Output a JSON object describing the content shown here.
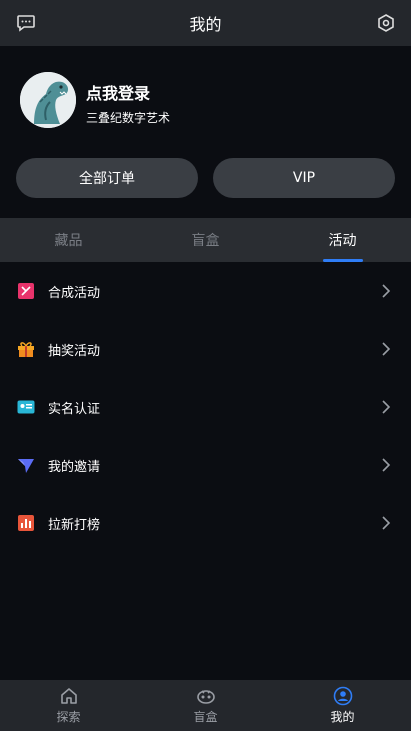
{
  "header": {
    "title": "我的",
    "left_icon": "chat-bubble-icon",
    "right_icon": "settings-hexagon-icon"
  },
  "profile": {
    "login_text": "点我登录",
    "subtitle": "三叠纪数字艺术",
    "avatar": "dinosaur-avatar"
  },
  "actions": {
    "orders_label": "全部订单",
    "vip_label": "VIP"
  },
  "tabs": [
    {
      "label": "藏品",
      "active": false
    },
    {
      "label": "盲盒",
      "active": false
    },
    {
      "label": "活动",
      "active": true
    }
  ],
  "menu": [
    {
      "label": "合成活动",
      "icon": "merge-icon",
      "color": "#e8336b"
    },
    {
      "label": "抽奖活动",
      "icon": "gift-icon",
      "color": "#f5a623"
    },
    {
      "label": "实名认证",
      "icon": "id-card-icon",
      "color": "#29b6d6"
    },
    {
      "label": "我的邀请",
      "icon": "paper-plane-icon",
      "color": "#5b6cf5"
    },
    {
      "label": "拉新打榜",
      "icon": "bar-chart-icon",
      "color": "#e8553a"
    }
  ],
  "bottom_nav": [
    {
      "label": "探索",
      "icon": "home-icon",
      "active": false
    },
    {
      "label": "盲盒",
      "icon": "blindbox-icon",
      "active": false
    },
    {
      "label": "我的",
      "icon": "user-icon",
      "active": true
    }
  ],
  "colors": {
    "accent": "#2f7df6",
    "bg": "#0b0d12",
    "bar": "#24272c"
  }
}
